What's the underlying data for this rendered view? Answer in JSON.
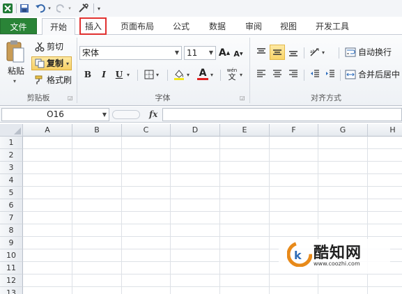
{
  "tabs": {
    "file": "文件",
    "home": "开始",
    "insert": "插入",
    "page_layout": "页面布局",
    "formulas": "公式",
    "data": "数据",
    "review": "审阅",
    "view": "视图",
    "developer": "开发工具"
  },
  "clipboard": {
    "paste": "粘贴",
    "cut": "剪切",
    "copy": "复制",
    "format_painter": "格式刷",
    "group_label": "剪贴板"
  },
  "font": {
    "name": "宋体",
    "size": "11",
    "bold": "B",
    "italic": "I",
    "underline": "U",
    "font_color_glyph": "A",
    "phonetic_glyph": "wén",
    "group_label": "字体"
  },
  "alignment": {
    "wrap_text": "自动换行",
    "merge_center": "合并后居中",
    "group_label": "对齐方式"
  },
  "formula_bar": {
    "name_box": "O16",
    "fx": "fx"
  },
  "columns": [
    "A",
    "B",
    "C",
    "D",
    "E",
    "F",
    "G",
    "H"
  ],
  "rows": [
    "1",
    "2",
    "3",
    "4",
    "5",
    "6",
    "7",
    "8",
    "9",
    "10",
    "11",
    "12",
    "13"
  ],
  "watermark": {
    "brand": "酷知网",
    "url": "www.coozhi.com"
  },
  "colors": {
    "file_tab": "#2a8437",
    "highlight": "#e0302f",
    "font_color": "#e02020",
    "fill_color": "#f3e81a"
  },
  "icons": [
    "excel-icon",
    "save-icon",
    "undo-icon",
    "redo-icon",
    "customize-icon",
    "paste-icon",
    "cut-icon",
    "copy-icon",
    "format-painter-icon",
    "borders-icon",
    "fill-color-icon",
    "font-color-icon",
    "phonetic-icon",
    "align-top-icon",
    "align-middle-icon",
    "align-bottom-icon",
    "orientation-icon",
    "wrap-text-icon",
    "align-left-icon",
    "align-center-icon",
    "align-right-icon",
    "decrease-indent-icon",
    "increase-indent-icon",
    "merge-icon",
    "dialog-launcher-icon"
  ]
}
